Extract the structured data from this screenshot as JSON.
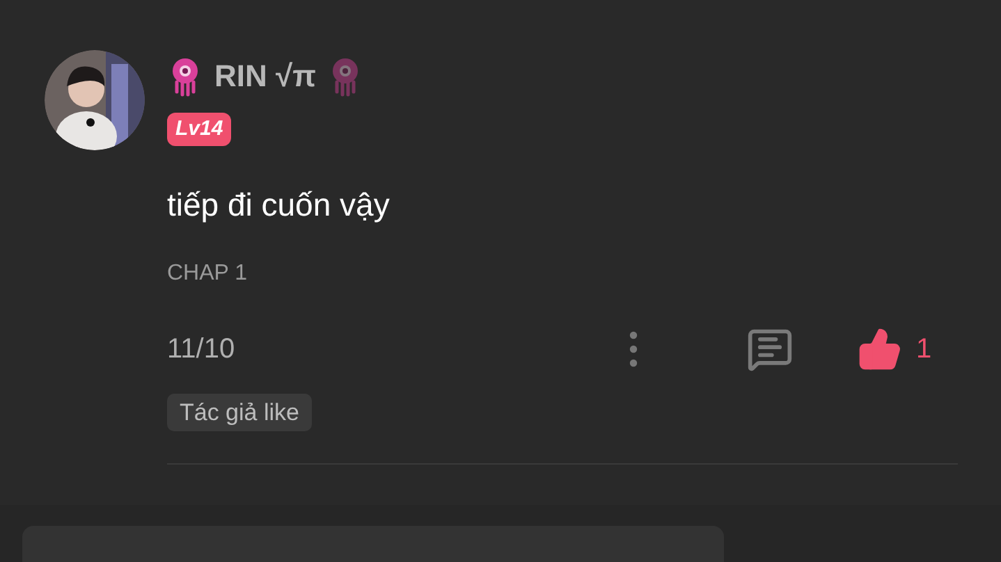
{
  "comment": {
    "user": {
      "name": "RIN √π",
      "level": "Lv14"
    },
    "text": "tiếp đi cuốn vậy",
    "chapter": "CHAP 1",
    "date": "11/10",
    "likes": "1",
    "liked": true,
    "tag": "Tác giả like"
  }
}
